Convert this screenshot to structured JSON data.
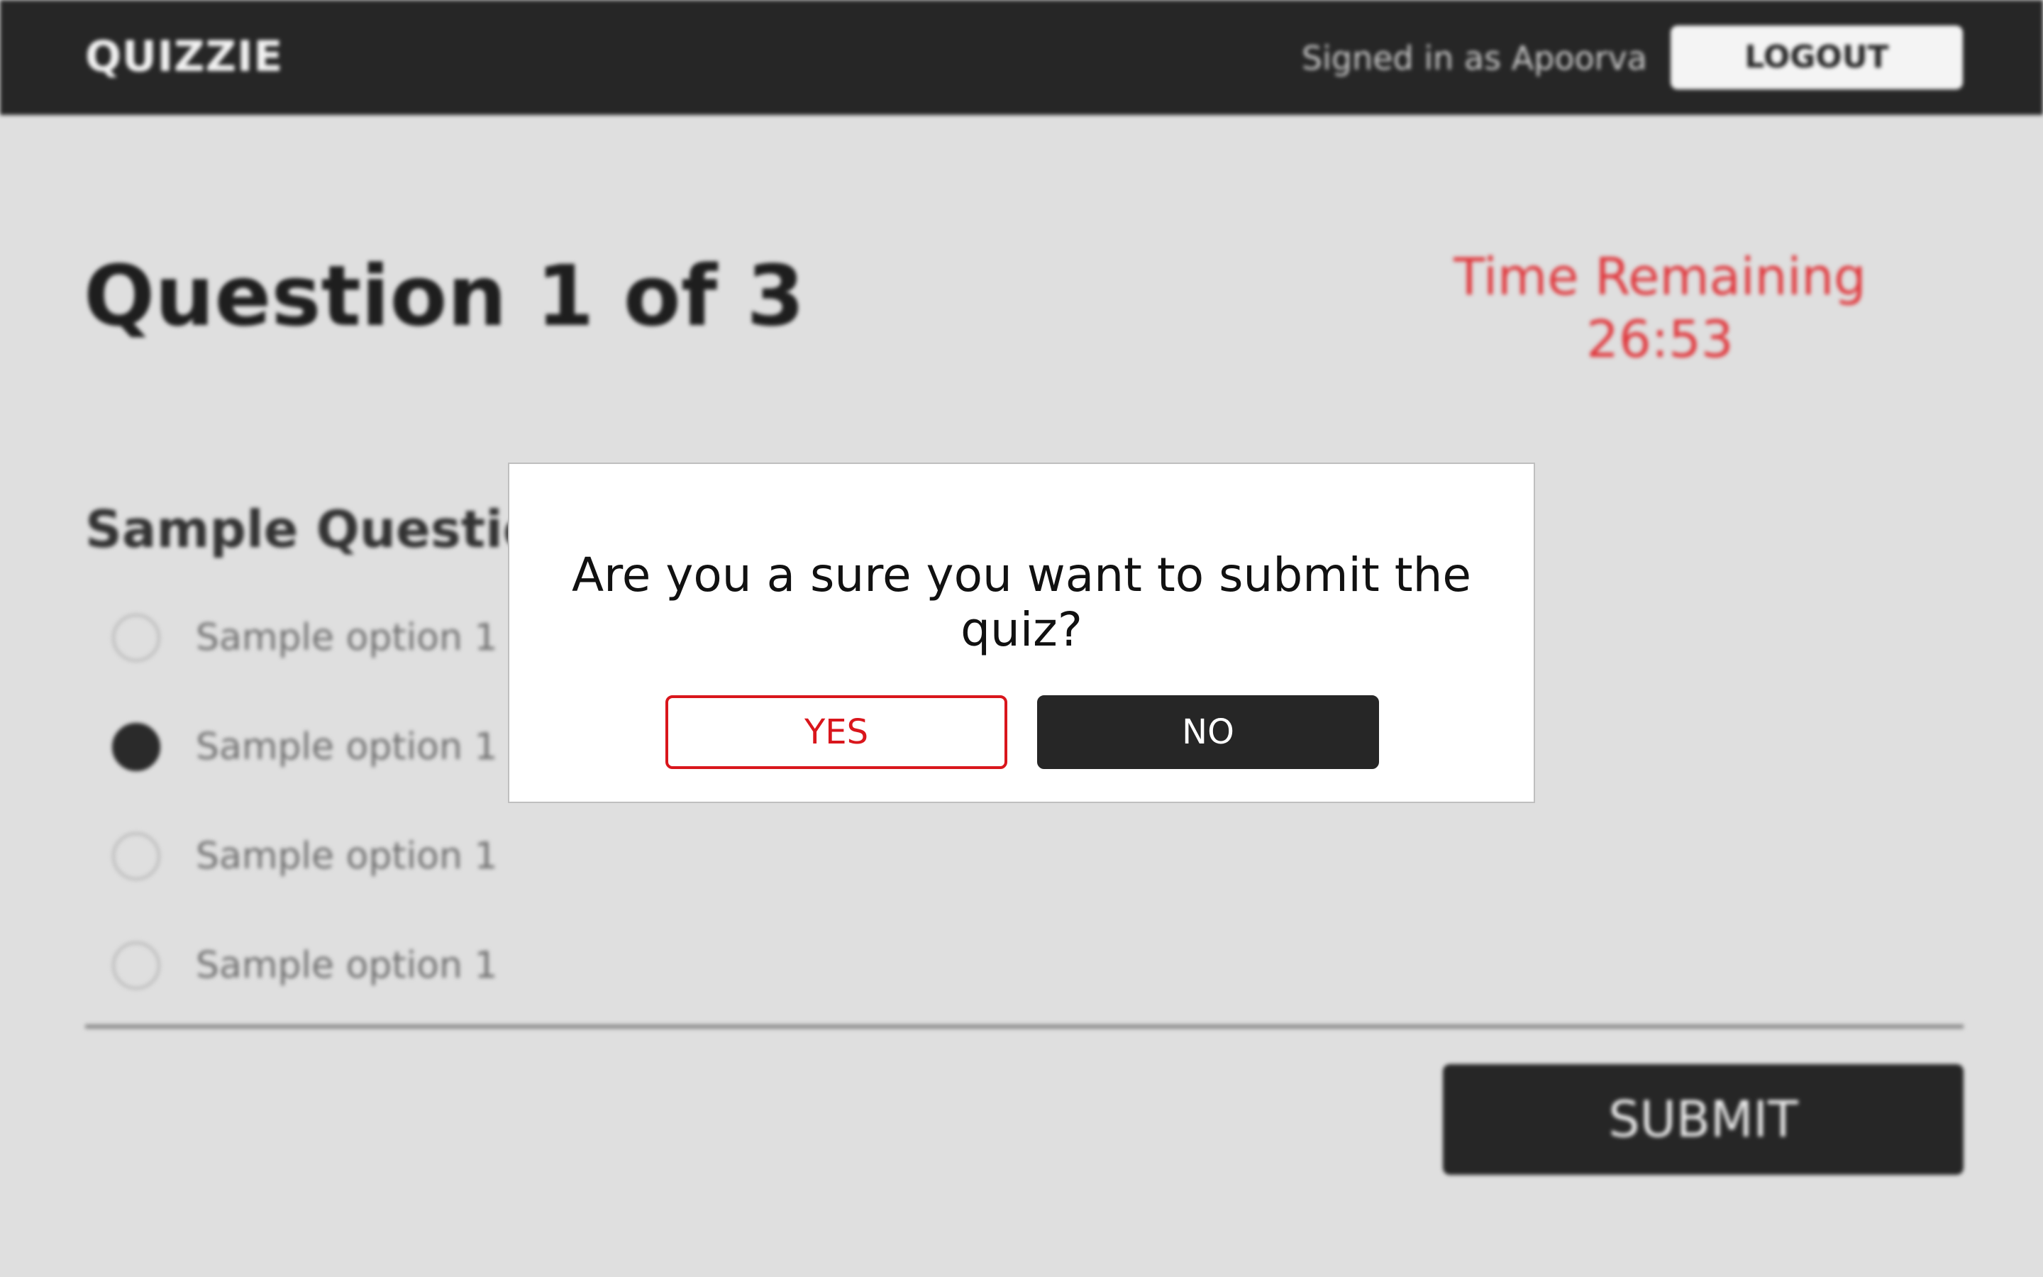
{
  "header": {
    "brand": "QUIZZIE",
    "signed_in_text": "Signed in as Apoorva",
    "logout_label": "LOGOUT"
  },
  "quiz": {
    "progress_label": "Question 1 of 3",
    "timer_label": "Time Remaining",
    "timer_value": "26:53",
    "question_text": "Sample Question",
    "options": [
      {
        "label": "Sample option 1",
        "selected": false
      },
      {
        "label": "Sample option 1",
        "selected": true
      },
      {
        "label": "Sample option 1",
        "selected": false
      },
      {
        "label": "Sample option 1",
        "selected": false
      }
    ],
    "submit_label": "SUBMIT"
  },
  "dialog": {
    "message": "Are you a sure you want to submit the quiz?",
    "yes_label": "YES",
    "no_label": "NO"
  },
  "colors": {
    "accent_red": "#d9161c",
    "dark": "#262626",
    "timer_red": "#e0393e"
  }
}
